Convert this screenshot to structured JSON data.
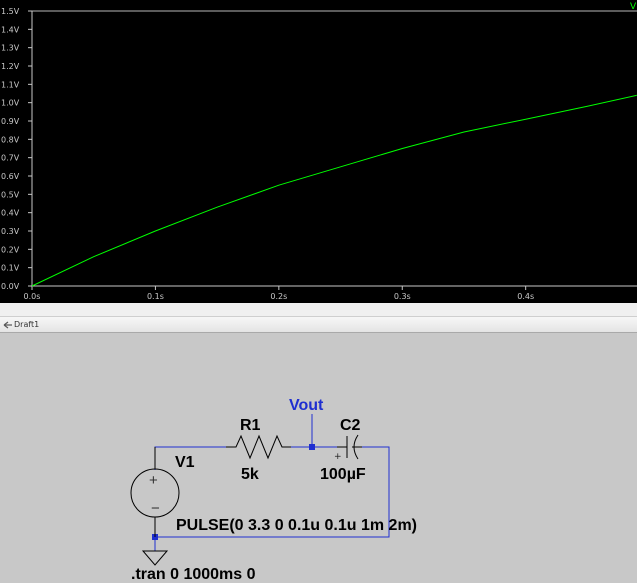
{
  "plot": {
    "trace_label": "V",
    "trace_color": "#00ff00",
    "background": "#000000",
    "axis_color": "#c8c8c8",
    "y_ticks": [
      "0.0V",
      "0.1V",
      "0.2V",
      "0.3V",
      "0.4V",
      "0.5V",
      "0.6V",
      "0.7V",
      "0.8V",
      "0.9V",
      "1.0V",
      "1.1V",
      "1.2V",
      "1.3V",
      "1.4V",
      "1.5V"
    ],
    "x_ticks": [
      "0.0s",
      "0.1s",
      "0.2s",
      "0.3s",
      "0.4s"
    ]
  },
  "chart_data": {
    "type": "line",
    "title": "",
    "xlabel": "",
    "ylabel": "",
    "xlim": [
      0,
      0.49
    ],
    "ylim": [
      0,
      1.5
    ],
    "grid": false,
    "series": [
      {
        "name": "V",
        "x": [
          0.0,
          0.05,
          0.1,
          0.15,
          0.2,
          0.25,
          0.3,
          0.35,
          0.4,
          0.45,
          0.49
        ],
        "y": [
          0.0,
          0.16,
          0.3,
          0.43,
          0.55,
          0.65,
          0.75,
          0.84,
          0.91,
          0.98,
          1.04
        ]
      }
    ]
  },
  "window": {
    "title": "Draft1"
  },
  "schematic": {
    "net_label": "Vout",
    "r1": {
      "ref": "R1",
      "value": "5k"
    },
    "c2": {
      "ref": "C2",
      "value": "100µF",
      "plus": "+"
    },
    "v1": {
      "ref": "V1",
      "value": "PULSE(0 3.3 0 0.1u 0.1u 1m 2m)",
      "plus": "+",
      "minus": "−"
    },
    "directive": ".tran 0 1000ms 0",
    "wire_color": "#1f2fd0",
    "net_label_color": "#1f2fd0",
    "background": "#c8c8c8"
  }
}
